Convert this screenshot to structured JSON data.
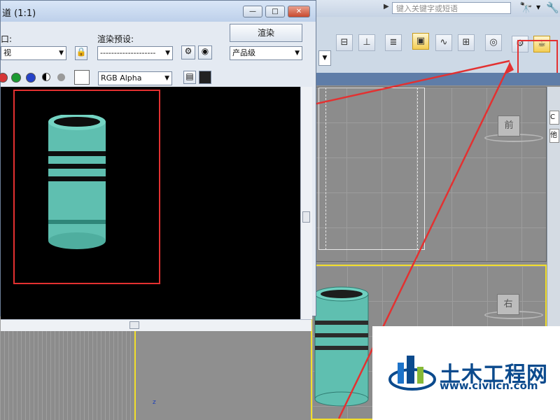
{
  "window_title": "道 (1:1)",
  "search": {
    "placeholder": "键入关键字或短语"
  },
  "render_window": {
    "viewport_label": "口:",
    "viewport_value": "视",
    "preset_label": "渲染预设:",
    "preset_value": "--------------------",
    "render_button": "渲染",
    "quality_value": "产品级",
    "channel_value": "RGB Alpha"
  },
  "viewports": {
    "top_cube_label": "前",
    "right_cube_label": "右",
    "side_panel_text": [
      "C",
      "他"
    ]
  },
  "logo": {
    "name": "土木工程网",
    "url": "www.civilcn.com"
  },
  "colors": {
    "highlight": "#e33131",
    "object": "#5fbfb0",
    "viewport_active": "#f2de2a"
  }
}
